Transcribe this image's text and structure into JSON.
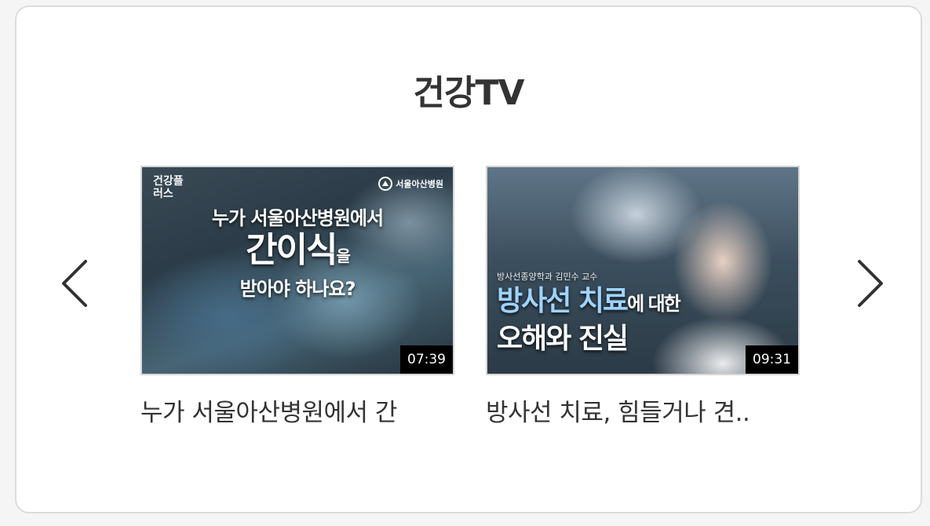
{
  "section": {
    "title": "건강TV"
  },
  "navigation": {
    "prev_icon": "chevron-left-icon",
    "next_icon": "chevron-right-icon"
  },
  "videos": [
    {
      "title": "누가 서울아산병원에서 간",
      "duration": "07:39",
      "thumbnail": {
        "corner_logo": "건강플러스",
        "hospital_name": "서울아산병원",
        "line1": "누가 서울아산병원에서",
        "line2": "간이식",
        "line2_suffix": "을",
        "line3": "받아야 하나요?"
      }
    },
    {
      "title": "방사선 치료, 힘들거나 견..",
      "duration": "09:31",
      "thumbnail": {
        "subtitle": "방사선종양학과 김민수 교수",
        "line1_highlight": "방사선 치료",
        "line1_suffix": "에 대한",
        "line2": "오해와 진실"
      }
    }
  ],
  "colors": {
    "title": "#333333",
    "card_border": "#dcdcdc",
    "duration_bg": "#000000"
  }
}
